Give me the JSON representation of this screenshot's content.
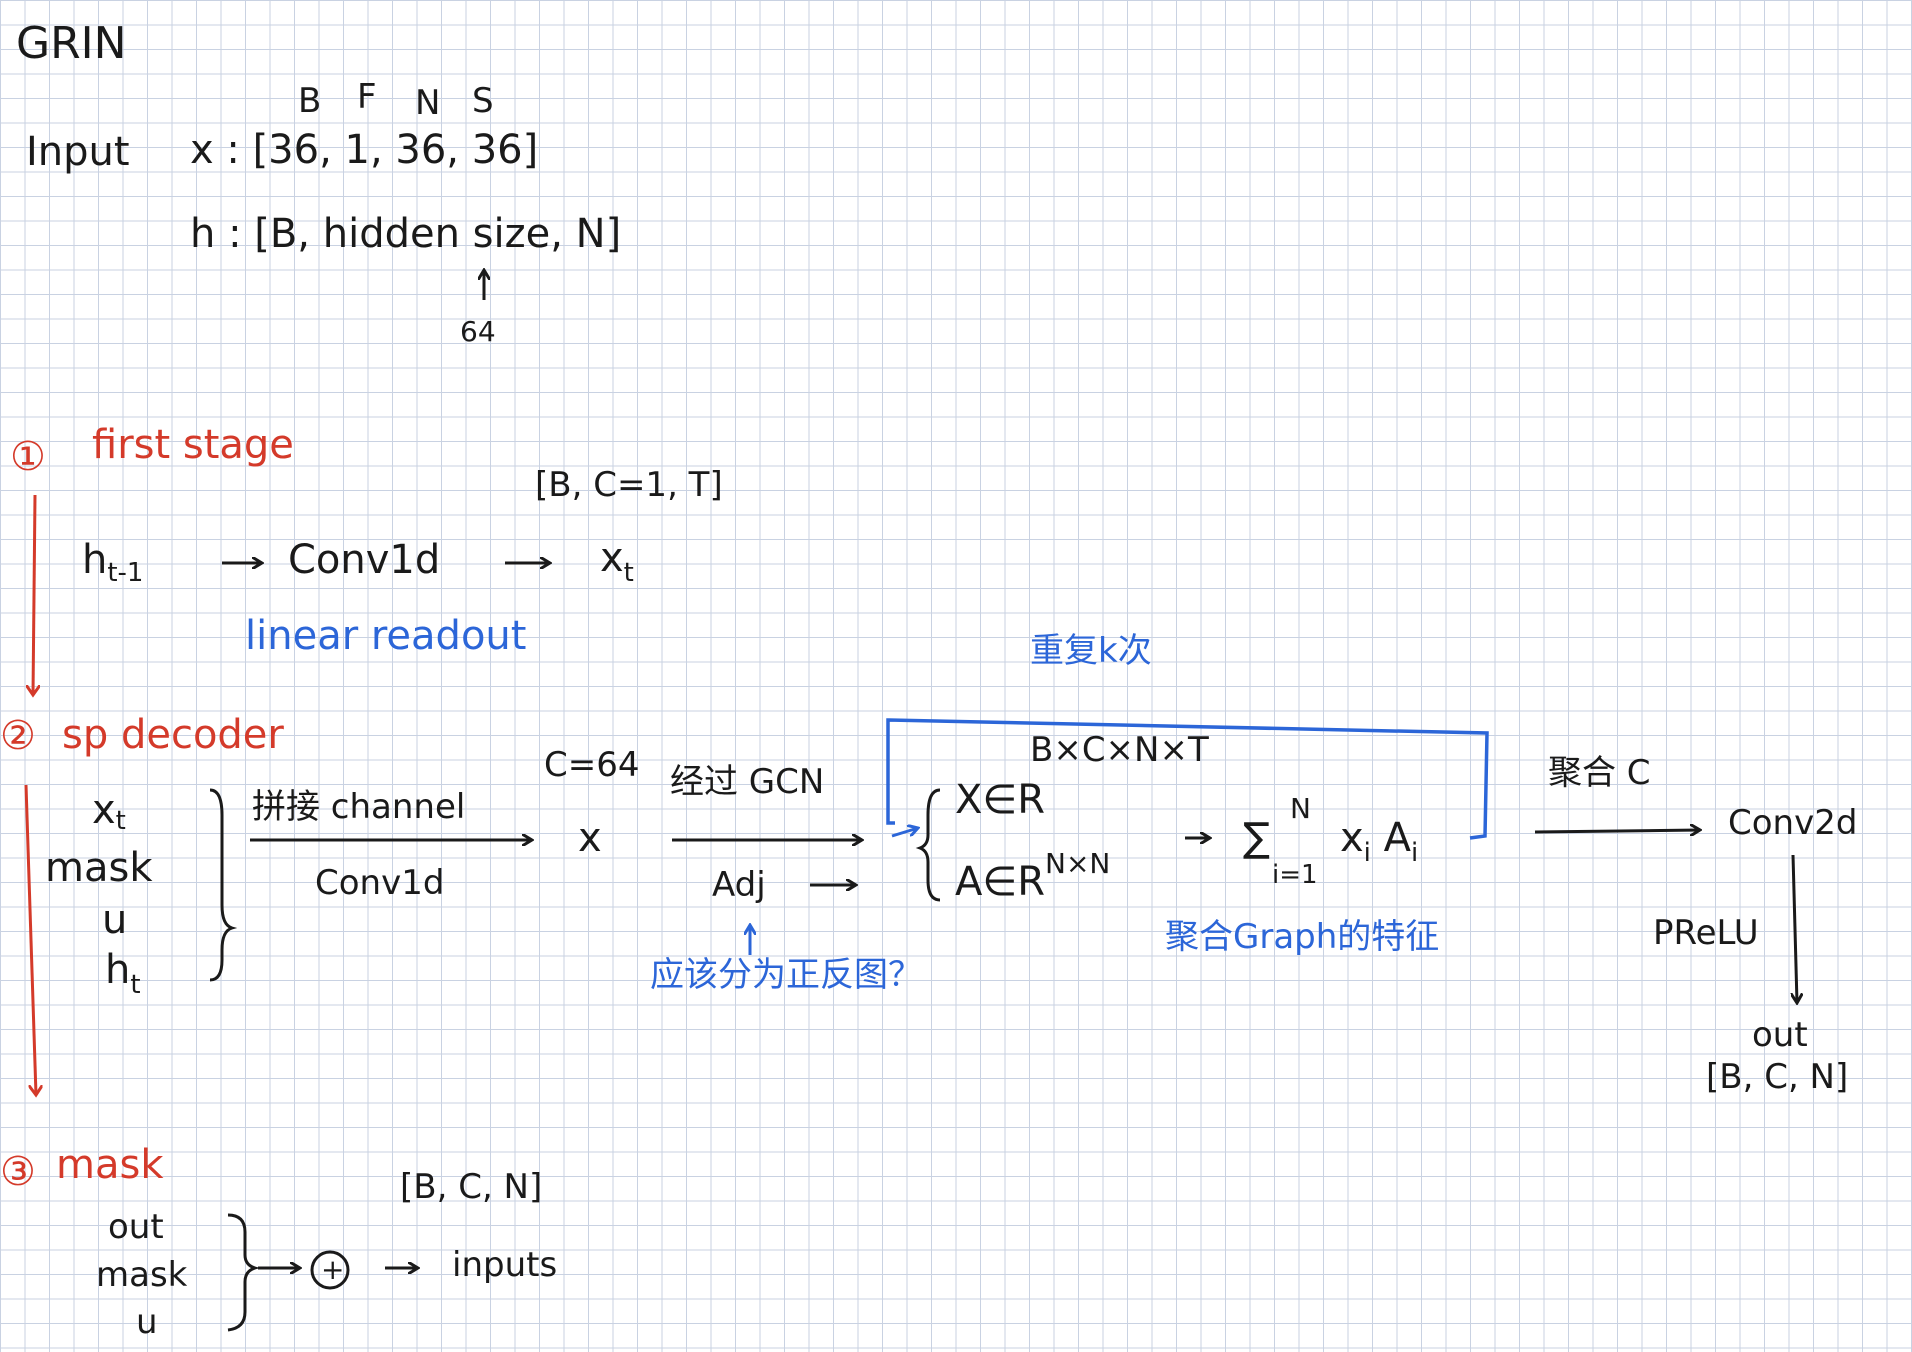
{
  "colors": {
    "ink": "#1a1a1a",
    "red": "#d43a2a",
    "blue": "#2c66d8",
    "grid": "#c9d2e2"
  },
  "title": "GRIN",
  "input": {
    "label": "Input",
    "dims": [
      "B",
      "F",
      "N",
      "S"
    ],
    "x_line": "x : [36, 1, 36, 36]",
    "h_line": "h : [B, hidden size, N]",
    "hidden_size_value": "64"
  },
  "first_stage": {
    "number": "①",
    "title": "first stage",
    "shape": "[B, C=1, T]",
    "h_prev": "h",
    "h_prev_sub": "t-1",
    "op": "Conv1d",
    "out": "x",
    "out_sub": "t",
    "note": "linear readout"
  },
  "sp_decoder": {
    "number": "②",
    "title": "sp decoder",
    "inputs": [
      "x",
      "mask",
      "u",
      "h"
    ],
    "input_subs": [
      "t",
      "",
      "",
      "t"
    ],
    "concat_label": "拼接 channel",
    "conv_label": "Conv1d",
    "c_label": "C=64",
    "x_label": "x",
    "gcn_label": "经过 GCN",
    "adj_label": "Adj",
    "adj_note": "应该分为正反图？",
    "repeat_label": "重复k次",
    "dims_label": "B×C×N×T",
    "x_in": "X∈R",
    "a_in": "A∈R",
    "a_sup": "N×N",
    "sum_sup": "N",
    "sum_sub": "i=1",
    "sum_term": "x",
    "sum_term_sub": "i",
    "sum_a": "A",
    "sum_a_sub": "i",
    "graph_note": "聚合Graph的特征",
    "agg_c": "聚合 C",
    "conv2d": "Conv2d",
    "prelu": "PReLU",
    "out": "out",
    "out_shape": "[B, C, N]"
  },
  "mask_stage": {
    "number": "③",
    "title": "mask",
    "inputs": [
      "out",
      "mask",
      "u"
    ],
    "op": "+",
    "result": "inputs",
    "shape": "[B, C, N]"
  }
}
